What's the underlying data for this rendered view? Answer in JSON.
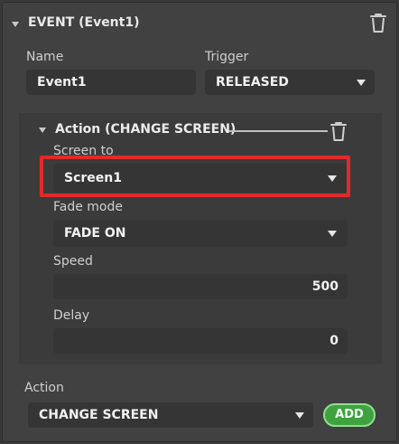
{
  "event": {
    "title": "EVENT (Event1)",
    "name_label": "Name",
    "name_value": "Event1",
    "trigger_label": "Trigger",
    "trigger_value": "RELEASED"
  },
  "action_block": {
    "title": "Action (CHANGE SCREEN)",
    "screen_to_label": "Screen to",
    "screen_to_value": "Screen1",
    "fade_mode_label": "Fade mode",
    "fade_mode_value": "FADE ON",
    "speed_label": "Speed",
    "speed_value": "500",
    "delay_label": "Delay",
    "delay_value": "0"
  },
  "footer": {
    "action_label": "Action",
    "action_value": "CHANGE SCREEN",
    "add_label": "ADD"
  },
  "colors": {
    "panel_bg": "#414141",
    "field_bg": "#353535",
    "highlight": "#e12a2a",
    "add_button": "#3fa23f"
  },
  "icons": [
    "collapse-arrow-icon",
    "trash-icon",
    "dropdown-caret-icon"
  ]
}
